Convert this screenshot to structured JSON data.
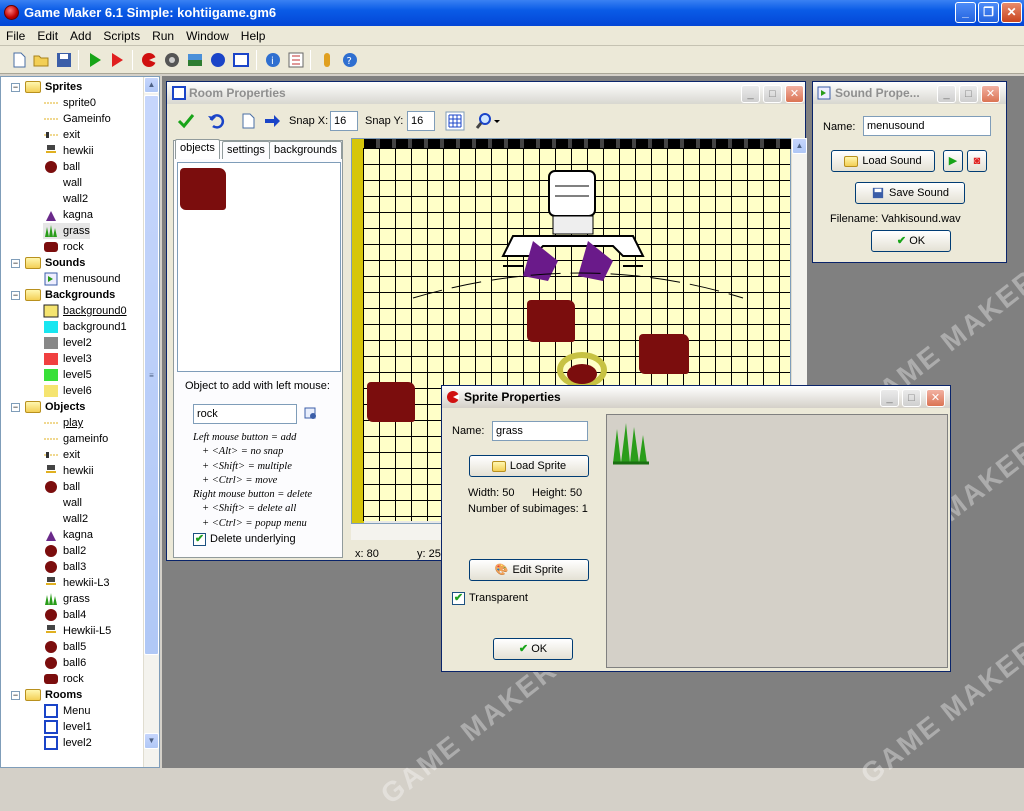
{
  "app": {
    "title": "Game Maker 6.1 Simple: kohtiigame.gm6"
  },
  "menu": [
    "File",
    "Edit",
    "Add",
    "Scripts",
    "Run",
    "Window",
    "Help"
  ],
  "toolbar_icons": [
    "new-file-icon",
    "open-folder-icon",
    "save-disk-icon",
    "run-icon",
    "run-debug-icon",
    "add-sprite-icon",
    "add-sound-icon",
    "add-background-icon",
    "add-object-icon",
    "add-room-icon",
    "game-info-icon",
    "global-settings-icon",
    "extensions-icon",
    "help-icon"
  ],
  "tree": {
    "sprites_label": "Sprites",
    "sprites": [
      "sprite0",
      "Gameinfo",
      "exit",
      "hewkii",
      "ball",
      "wall",
      "wall2",
      "kagna",
      "grass",
      "rock"
    ],
    "sounds_label": "Sounds",
    "sounds": [
      "menusound"
    ],
    "backgrounds_label": "Backgrounds",
    "backgrounds": [
      "background0",
      "background1",
      "level2",
      "level3",
      "level5",
      "level6"
    ],
    "objects_label": "Objects",
    "objects": [
      "play",
      "gameinfo",
      "exit",
      "hewkii",
      "ball",
      "wall",
      "wall2",
      "kagna",
      "ball2",
      "ball3",
      "hewkii-L3",
      "grass",
      "ball4",
      "Hewkii-L5",
      "ball5",
      "ball6",
      "rock"
    ],
    "rooms_label": "Rooms",
    "rooms": [
      "Menu",
      "level1",
      "level2"
    ]
  },
  "room": {
    "title": "Room Properties",
    "snapx_label": "Snap X:",
    "snapx": "16",
    "snapy_label": "Snap Y:",
    "snapy": "16",
    "tabs": [
      "objects",
      "settings",
      "backgrounds"
    ],
    "object_to_add_label": "Object to add with left mouse:",
    "object_value": "rock",
    "help": [
      "Left mouse button = add",
      "+ <Alt> = no snap",
      "+ <Shift> = multiple",
      "+ <Ctrl> = move",
      "Right mouse button = delete",
      "+ <Shift> = delete all",
      "+ <Ctrl> = popup menu"
    ],
    "delete_underlying": "Delete underlying",
    "status_x": "x: 80",
    "status_y": "y: 25"
  },
  "sound": {
    "title": "Sound Prope...",
    "name_label": "Name:",
    "name": "menusound",
    "load": "Load Sound",
    "save": "Save Sound",
    "filename": "Filename: Vahkisound.wav",
    "ok": "OK"
  },
  "sprite": {
    "title": "Sprite Properties",
    "name_label": "Name:",
    "name": "grass",
    "load": "Load Sprite",
    "width": "Width: 50",
    "height": "Height: 50",
    "subimages": "Number of subimages: 1",
    "edit": "Edit Sprite",
    "transparent": "Transparent",
    "ok": "OK"
  },
  "watermark": "GAME MAKER",
  "colors": {
    "rock": "#7b0d0d",
    "grid_bg": "#ffffc8",
    "grass": "#2a9d1a",
    "ball": "#7b0d0d"
  }
}
